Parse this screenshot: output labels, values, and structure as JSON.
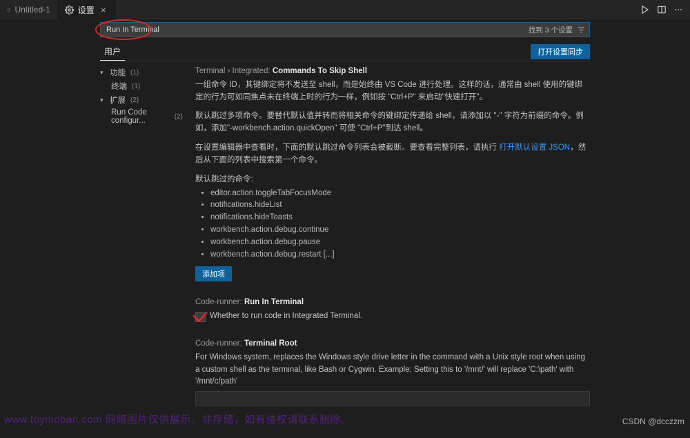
{
  "tabs": {
    "inactive": {
      "label": "Untitled-1"
    },
    "active": {
      "label": "设置"
    }
  },
  "search": {
    "value": "Run In Terminal",
    "result_text": "找到 3 个设置"
  },
  "scope": {
    "user_tab": "用户",
    "sync_button": "打开设置同步"
  },
  "toc": {
    "group1": {
      "label": "功能",
      "count": "(1)"
    },
    "group1_item1": {
      "label": "终端",
      "count": "(1)"
    },
    "group2": {
      "label": "扩展",
      "count": "(2)"
    },
    "group2_item1": {
      "label": "Run Code configur...",
      "count": "(2)"
    }
  },
  "settings": {
    "commandsToSkip": {
      "path": "Terminal › Integrated: ",
      "name": "Commands To Skip Shell",
      "para1": "一组命令 ID，其键绑定将不发送至 shell，而是始终由 VS Code 进行处理。这样的话，通常由 shell 使用的键绑定的行为可如同焦点未在终端上时的行为一样，例如按 \"Ctrl+P\" 来启动\"快速打开\"。",
      "para2": "默认跳过多项命令。要替代默认值并转而将相关命令的键绑定传递给 shell，请添加以 \"-\" 字符为前缀的命令。例如，添加\"-workbench.action.quickOpen\" 可使 \"Ctrl+P\"到达 shell。",
      "para3a": "在设置编辑器中查看时，下面的默认跳过命令列表会被截断。要查看完整列表，请执行 ",
      "para3_link": "打开默认设置 JSON",
      "para3b": "，然后从下面的列表中搜索第一个命令。",
      "sub_heading": "默认跳过的命令:",
      "items": [
        "editor.action.toggleTabFocusMode",
        "notifications.hideList",
        "notifications.hideToasts",
        "workbench.action.debug.continue",
        "workbench.action.debug.pause",
        "workbench.action.debug.restart [...]"
      ],
      "add_button": "添加项"
    },
    "runInTerminal": {
      "path": "Code-runner: ",
      "name": "Run In Terminal",
      "desc": "Whether to run code in Integrated Terminal."
    },
    "terminalRoot": {
      "path": "Code-runner: ",
      "name": "Terminal Root",
      "desc": "For Windows system, replaces the Windows style drive letter in the command with a Unix style root when using a custom shell as the terminal, like Bash or Cygwin. Example: Setting this to '/mnt/' will replace 'C:\\path' with '/mnt/c/path'"
    }
  },
  "footer": {
    "watermark": "www.toymoban.com 网络图片仅供展示，非存储，如有侵权请联系删除。",
    "credit": "CSDN @dcczzm"
  }
}
